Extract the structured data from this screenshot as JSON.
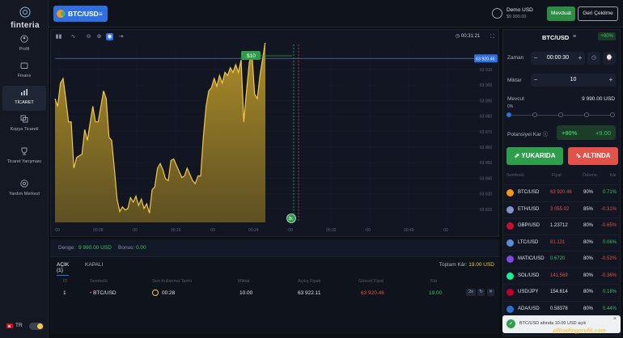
{
  "brand": {
    "name": "finteria"
  },
  "sidebar": {
    "items": [
      {
        "label": "Profil",
        "icon": "user-circle-icon"
      },
      {
        "label": "Finans",
        "icon": "folder-icon"
      },
      {
        "label": "TİCARET",
        "icon": "trade-chart-icon",
        "active": true
      },
      {
        "label": "Kopya Ticareti",
        "icon": "copy-trade-icon"
      },
      {
        "label": "Ticaret Yarışması",
        "icon": "trophy-icon"
      },
      {
        "label": "Yardım Merkezi",
        "icon": "help-icon"
      }
    ],
    "language": "TR"
  },
  "topbar": {
    "asset_label": "BTC/USD",
    "account_name": "Demo USD",
    "account_balance": "$9 990.00",
    "deposit_label": "Mevduat",
    "withdraw_label": "Geri Çekilme"
  },
  "chart": {
    "timer": "00:31:21",
    "price_tag": "63 920.46",
    "trade_tag": "$10",
    "trade_marker": "2k",
    "y_ticks": [
      "63 910",
      "63 900",
      "63 890",
      "63 880",
      "63 870",
      "63 860",
      "63 850",
      "63 840",
      "63 830",
      "63 820"
    ],
    "x_ticks": [
      ":00",
      "00:08",
      ":00",
      "00:16",
      ":00",
      "00:24",
      ":00",
      "00:32",
      ":00",
      "00:40",
      ":00"
    ]
  },
  "chart_data": {
    "type": "area",
    "title": "",
    "xlabel": "",
    "ylabel": "",
    "ylim": [
      63815,
      63930
    ],
    "series": [
      {
        "values": [
          63895,
          63890,
          63905,
          63908,
          63895,
          63880,
          63880,
          63850,
          63857,
          63858,
          63859,
          63875,
          63868,
          63879,
          63890,
          63880,
          63880,
          63890,
          63900,
          63895,
          63870,
          63868,
          63850,
          63830,
          63822,
          63825,
          63823,
          63824,
          63831,
          63828,
          63832,
          63826,
          63830,
          63824,
          63827,
          63821,
          63836,
          63838,
          63850,
          63853,
          63849,
          63843,
          63842,
          63855,
          63856,
          63852,
          63848,
          63844,
          63845,
          63850,
          63846,
          63842,
          63840,
          63845,
          63845,
          63870,
          63890,
          63900,
          63902,
          63908,
          63903,
          63910,
          63905,
          63912,
          63910,
          63915,
          63912,
          63917,
          63912,
          63920,
          63880,
          63900,
          63918,
          63925,
          63898,
          63895,
          63910,
          63921,
          63932
        ]
      }
    ]
  },
  "balance_bar": {
    "balance_label": "Denge:",
    "balance_value": "9 990.00 USD",
    "bonus_label": "Bonus:",
    "bonus_value": "0.00"
  },
  "trades": {
    "tab_open": "AÇIK (1)",
    "tab_closed": "KAPALI",
    "total_label": "Toplam Kâr:",
    "total_value": "19.00 USD",
    "headers": [
      "ID",
      "Sembolü",
      "Son Kullanma Tarihi",
      "Miktar",
      "Açılış Fiyatı",
      "Güncel Fiyat",
      "Kâr"
    ],
    "rows": [
      {
        "id": "1",
        "symbol": "BTC/USD",
        "expiry": "00:28",
        "amount": "10.00",
        "open_price": "63 922.11",
        "current_price": "63 920.46",
        "profit": "19.00",
        "mult": "2x"
      }
    ]
  },
  "panel": {
    "pair": "BTC/USD",
    "payout_badge": "+90%",
    "time_label": "Zaman",
    "time_value": "00:00:30",
    "amount_label": "Miktar",
    "amount_value": "10",
    "available_label": "Mevcut",
    "available_value": "9 990.00 USD",
    "slider_pct": "0%",
    "profit_label": "Potansiyel Kar",
    "profit_pct": "+90%",
    "profit_amount": "+9.00",
    "up_label": "YUKARIDA",
    "down_label": "ALTINDA",
    "market_headers": [
      "Sembolü",
      "Fiyat",
      "Ödeme",
      "Kâr"
    ],
    "markets": [
      {
        "symbol": "BTC/USD",
        "price": "63 920.46",
        "price_color": "#e0524a",
        "payout": "90%",
        "change": "0.71%",
        "change_color": "#3cc06a",
        "coin_color": "#f7931a"
      },
      {
        "symbol": "ETH/USD",
        "price": "3 055.02",
        "price_color": "#e0524a",
        "payout": "85%",
        "change": "-0.31%",
        "change_color": "#e0524a",
        "coin_color": "#8a92c9"
      },
      {
        "symbol": "GBP/USD",
        "price": "1.23712",
        "price_color": "#e1e4ea",
        "payout": "80%",
        "change": "-0.65%",
        "change_color": "#e0524a",
        "coin_color": "#c8102e"
      },
      {
        "symbol": "LTC/USD",
        "price": "81.131",
        "price_color": "#e0524a",
        "payout": "80%",
        "change": "0.06%",
        "change_color": "#3cc06a",
        "coin_color": "#5b8bd6"
      },
      {
        "symbol": "MATIC/USD",
        "price": "0.6720",
        "price_color": "#3cc06a",
        "payout": "80%",
        "change": "-0.52%",
        "change_color": "#e0524a",
        "coin_color": "#8247e5"
      },
      {
        "symbol": "SOL/USD",
        "price": "141.569",
        "price_color": "#e0524a",
        "payout": "80%",
        "change": "-0.36%",
        "change_color": "#e0524a",
        "coin_color": "#14f195"
      },
      {
        "symbol": "USD/JPY",
        "price": "154.614",
        "price_color": "#e1e4ea",
        "payout": "80%",
        "change": "0.18%",
        "change_color": "#3cc06a",
        "coin_color": "#bc002d"
      },
      {
        "symbol": "ADA/USD",
        "price": "0.58378",
        "price_color": "#e1e4ea",
        "payout": "80%",
        "change": "0.44%",
        "change_color": "#3cc06a",
        "coin_color": "#2a71d0"
      }
    ]
  },
  "toast": {
    "message": "BTC/USD altında 10.00 USD açık"
  },
  "watermark": "alltradingprofit.com"
}
